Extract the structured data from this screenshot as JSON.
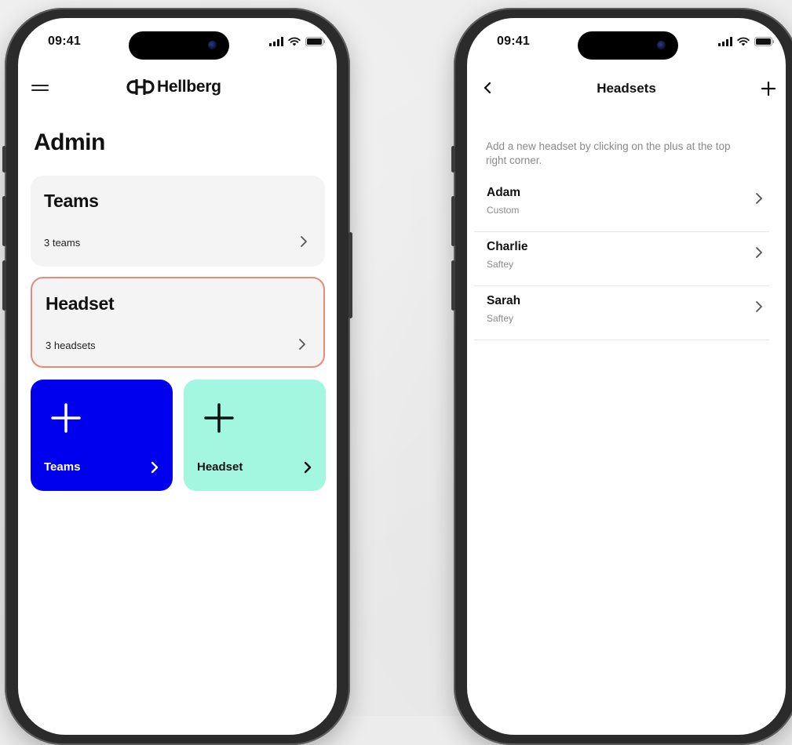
{
  "status_bar": {
    "time": "09:41"
  },
  "admin_screen": {
    "brand": "Hellberg",
    "title": "Admin",
    "cards": [
      {
        "title": "Teams",
        "subtitle": "3 teams"
      },
      {
        "title": "Headset",
        "subtitle": "3 headsets"
      }
    ],
    "quick_actions": [
      {
        "label": "Teams",
        "color": "#0000ee"
      },
      {
        "label": "Headset",
        "color": "#a3f6e0"
      }
    ]
  },
  "headsets_screen": {
    "title": "Headsets",
    "hint": "Add a new headset by clicking on the plus at the top right corner.",
    "items": [
      {
        "name": "Adam",
        "type": "Custom"
      },
      {
        "name": "Charlie",
        "type": "Saftey"
      },
      {
        "name": "Sarah",
        "type": "Saftey"
      }
    ]
  },
  "colors": {
    "accent_blue": "#0000ee",
    "accent_mint": "#a3f6e0",
    "selected_border": "#e98a76"
  },
  "icons": [
    "menu-icon",
    "hellberg-logo-icon",
    "chevron-right-icon",
    "plus-icon",
    "back-chevron-icon",
    "signal-icon",
    "wifi-icon",
    "battery-icon"
  ]
}
